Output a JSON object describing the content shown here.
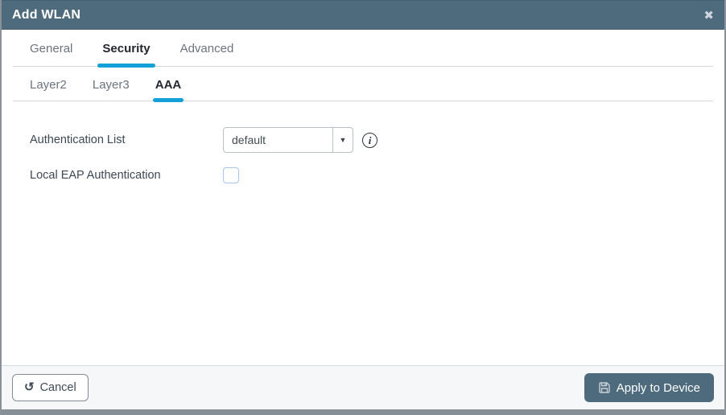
{
  "dialog": {
    "title": "Add WLAN",
    "close_icon": "✖"
  },
  "tabs": [
    {
      "label": "General",
      "active": false
    },
    {
      "label": "Security",
      "active": true
    },
    {
      "label": "Advanced",
      "active": false
    }
  ],
  "subtabs": [
    {
      "label": "Layer2",
      "active": false
    },
    {
      "label": "Layer3",
      "active": false
    },
    {
      "label": "AAA",
      "active": true
    }
  ],
  "form": {
    "authentication_list": {
      "label": "Authentication List",
      "value": "default",
      "arrow_icon": "▼",
      "info_icon": "i"
    },
    "local_eap": {
      "label": "Local EAP Authentication",
      "checked": false
    }
  },
  "footer": {
    "cancel_label": "Cancel",
    "cancel_icon": "↺",
    "apply_label": "Apply to Device"
  },
  "colors": {
    "header_bg": "#4e6b7e",
    "accent_blue": "#14a0d9",
    "apply_bg": "#4e6b7e",
    "footer_bg": "#f6f7f8",
    "checkbox_border": "#a8c6e8",
    "bottom_strip": "#878f96"
  }
}
